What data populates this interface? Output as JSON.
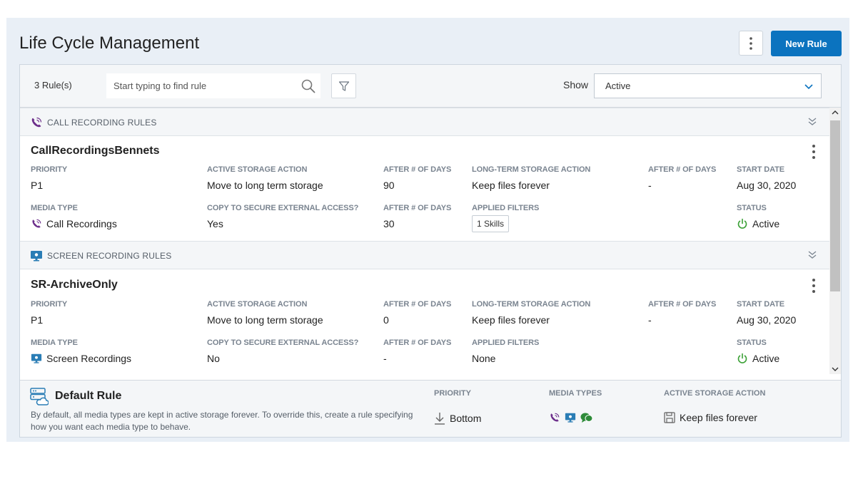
{
  "header": {
    "title": "Life Cycle Management",
    "new_rule_label": "New Rule"
  },
  "toolbar": {
    "rule_count": "3 Rule(s)",
    "search_placeholder": "Start typing to find rule",
    "show_label": "Show",
    "show_value": "Active"
  },
  "groups": [
    {
      "title": "CALL RECORDING RULES",
      "icon": "phone-recording-icon",
      "rule": {
        "name": "CallRecordingsBennets",
        "labels": {
          "priority": "PRIORITY",
          "active_storage_action": "ACTIVE STORAGE ACTION",
          "after_days_1": "AFTER # OF DAYS",
          "long_term_action": "LONG-TERM STORAGE ACTION",
          "after_days_2": "AFTER # OF DAYS",
          "start_date": "START DATE",
          "media_type": "MEDIA TYPE",
          "copy_external": "COPY TO SECURE EXTERNAL ACCESS?",
          "after_days_3": "AFTER # OF DAYS",
          "applied_filters": "APPLIED FILTERS",
          "status": "STATUS"
        },
        "values": {
          "priority": "P1",
          "active_storage_action": "Move to long term storage",
          "after_days_1": "90",
          "long_term_action": "Keep files forever",
          "after_days_2": "-",
          "start_date": "Aug 30, 2020",
          "media_type": "Call Recordings",
          "copy_external": "Yes",
          "after_days_3": "30",
          "applied_filters": "1 Skills",
          "status": "Active"
        }
      }
    },
    {
      "title": "SCREEN RECORDING RULES",
      "icon": "screen-recording-icon",
      "rule": {
        "name": "SR-ArchiveOnly",
        "labels": {
          "priority": "PRIORITY",
          "active_storage_action": "ACTIVE STORAGE ACTION",
          "after_days_1": "AFTER # OF DAYS",
          "long_term_action": "LONG-TERM STORAGE ACTION",
          "after_days_2": "AFTER # OF DAYS",
          "start_date": "START DATE",
          "media_type": "MEDIA TYPE",
          "copy_external": "COPY TO SECURE EXTERNAL ACCESS?",
          "after_days_3": "AFTER # OF DAYS",
          "applied_filters": "APPLIED FILTERS",
          "status": "STATUS"
        },
        "values": {
          "priority": "P1",
          "active_storage_action": "Move to long term storage",
          "after_days_1": "0",
          "long_term_action": "Keep files forever",
          "after_days_2": "-",
          "start_date": "Aug 30, 2020",
          "media_type": "Screen Recordings",
          "copy_external": "No",
          "after_days_3": "-",
          "applied_filters": "None",
          "status": "Active"
        }
      }
    }
  ],
  "default_rule": {
    "title": "Default Rule",
    "description": "By default, all media types are kept in active storage forever. To override this, create a rule specifying how you want each media type to behave.",
    "priority_label": "PRIORITY",
    "priority_value": "Bottom",
    "media_types_label": "MEDIA TYPES",
    "active_storage_label": "ACTIVE STORAGE ACTION",
    "active_storage_value": "Keep files forever"
  },
  "colors": {
    "accent": "#0b73bf",
    "phone_icon": "#6b2d8a",
    "screen_icon": "#2a7db5",
    "chat_icon": "#2e8b3a",
    "status_active": "#3aa035",
    "background": "#e9eff6"
  }
}
